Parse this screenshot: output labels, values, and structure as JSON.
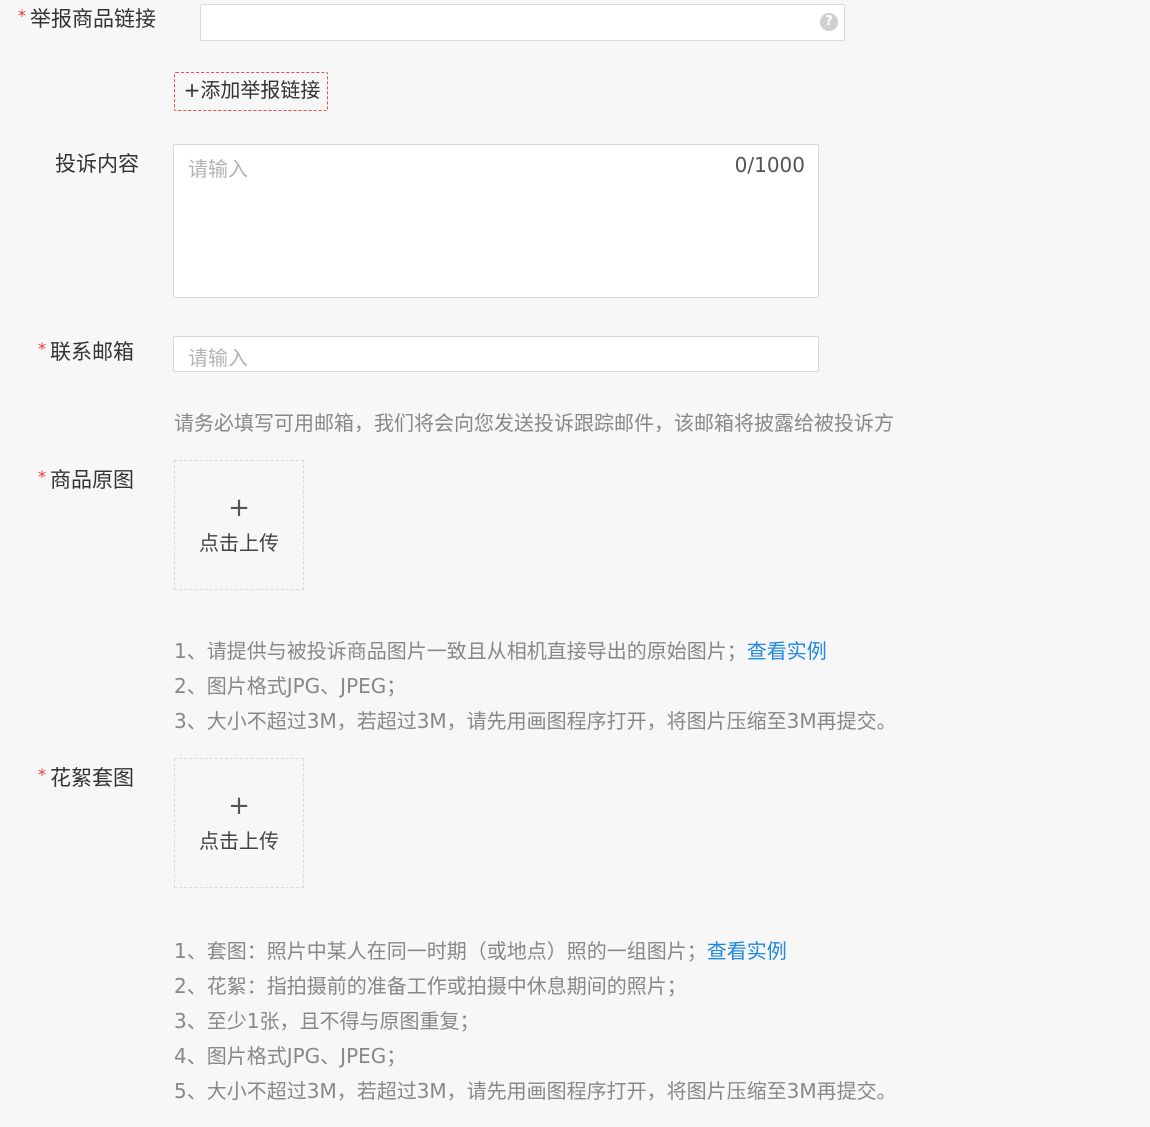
{
  "report_link": {
    "required_mark": "*",
    "label": "举报商品链接",
    "value": "",
    "help_icon_glyph": "?",
    "add_button_label": "+添加举报链接"
  },
  "complaint": {
    "label": "投诉内容",
    "placeholder": "请输入",
    "counter": "0/1000"
  },
  "email": {
    "required_mark": "*",
    "label": "联系邮箱",
    "placeholder": "请输入",
    "hint": "请务必填写可用邮箱，我们将会向您发送投诉跟踪邮件，该邮箱将披露给被投诉方"
  },
  "original_image": {
    "required_mark": "*",
    "label": "商品原图",
    "upload_plus": "+",
    "upload_label": "点击上传",
    "notes": [
      "1、请提供与被投诉商品图片一致且从相机直接导出的原始图片；",
      "2、图片格式JPG、JPEG；",
      "3、大小不超过3M，若超过3M，请先用画图程序打开，将图片压缩至3M再提交。"
    ],
    "example_link": "查看实例"
  },
  "bts_image": {
    "required_mark": "*",
    "label": "花絮套图",
    "upload_plus": "+",
    "upload_label": "点击上传",
    "notes": [
      "1、套图：照片中某人在同一时期（或地点）照的一组图片；",
      "2、花絮：指拍摄前的准备工作或拍摄中休息期间的照片；",
      "3、至少1张，且不得与原图重复；",
      "4、图片格式JPG、JPEG；",
      "5、大小不超过3M，若超过3M，请先用画图程序打开，将图片压缩至3M再提交。"
    ],
    "example_link": "查看实例"
  },
  "colors": {
    "required": "#e53935",
    "link": "#1e88e5",
    "dashed_button_border": "#e94b4b",
    "background": "#f7f7f7"
  }
}
